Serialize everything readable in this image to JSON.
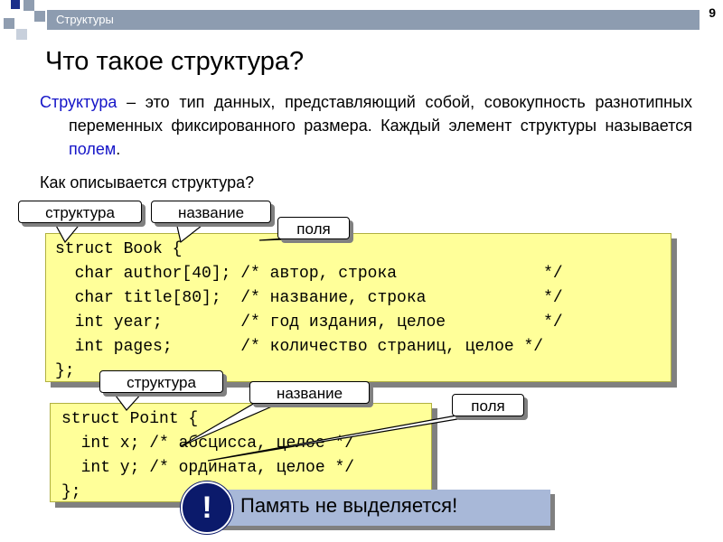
{
  "header": {
    "title": "Структуры",
    "page_number": "9"
  },
  "slide": {
    "title": "Что такое структура?",
    "definition": {
      "term": "Структура",
      "text_before_field": " – это тип данных, представляющий собой, совокупность разнотипных переменных фиксированного размера. Каждый элемент структуры называется ",
      "field_term": "полем",
      "period": "."
    },
    "question": "Как описывается структура?"
  },
  "code1": {
    "lines": [
      "struct Book {",
      "  char author[40]; /* автор, строка               */",
      "  char title[80];  /* название, строка            */",
      "  int year;        /* год издания, целое          */",
      "  int pages;       /* количество страниц, целое */",
      "};"
    ]
  },
  "code2": {
    "lines": [
      "struct Point {",
      "  int x; /* абсцисса, целое */",
      "  int y; /* ордината, целое */",
      "};"
    ]
  },
  "callouts": {
    "struct1": "структура",
    "name1": "название",
    "fields1": "поля",
    "struct2": "структура",
    "name2": "название",
    "fields2": "поля"
  },
  "banner": {
    "text": "Память не выделяется!",
    "icon": "exclamation-icon",
    "symbol": "!"
  },
  "colors": {
    "header": "#8d9cb0",
    "code_bg": "#ffff99",
    "accent_blue": "#1515c8",
    "banner_bg": "#a8b8d8",
    "icon_bg": "#0b1a6b"
  }
}
